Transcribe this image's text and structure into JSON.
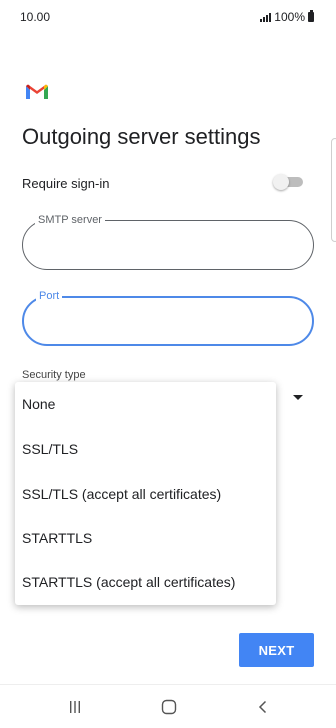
{
  "status_bar": {
    "time": "10.00",
    "battery": "100%",
    "icons": [
      "signal-icon",
      "battery-icon"
    ]
  },
  "header": {
    "logo": "gmail-logo",
    "title": "Outgoing server settings"
  },
  "settings": {
    "require_signin_label": "Require sign-in",
    "require_signin_on": false,
    "smtp_server": {
      "label": "SMTP server",
      "value": ""
    },
    "port": {
      "label": "Port",
      "value": ""
    },
    "security_type_label": "Security type"
  },
  "security_menu": {
    "options": [
      "None",
      "SSL/TLS",
      "SSL/TLS (accept all certificates)",
      "STARTTLS",
      "STARTTLS (accept all certificates)"
    ]
  },
  "actions": {
    "next_label": "NEXT"
  },
  "nav": {
    "icons": [
      "recent-apps-icon",
      "home-icon",
      "back-icon"
    ]
  },
  "colors": {
    "accent": "#4285f4",
    "focus_outline": "#4e89e8",
    "gmail_red": "#ea4335",
    "gmail_blue": "#4285f4",
    "gmail_green": "#34a853",
    "gmail_yellow": "#fbbc04"
  }
}
